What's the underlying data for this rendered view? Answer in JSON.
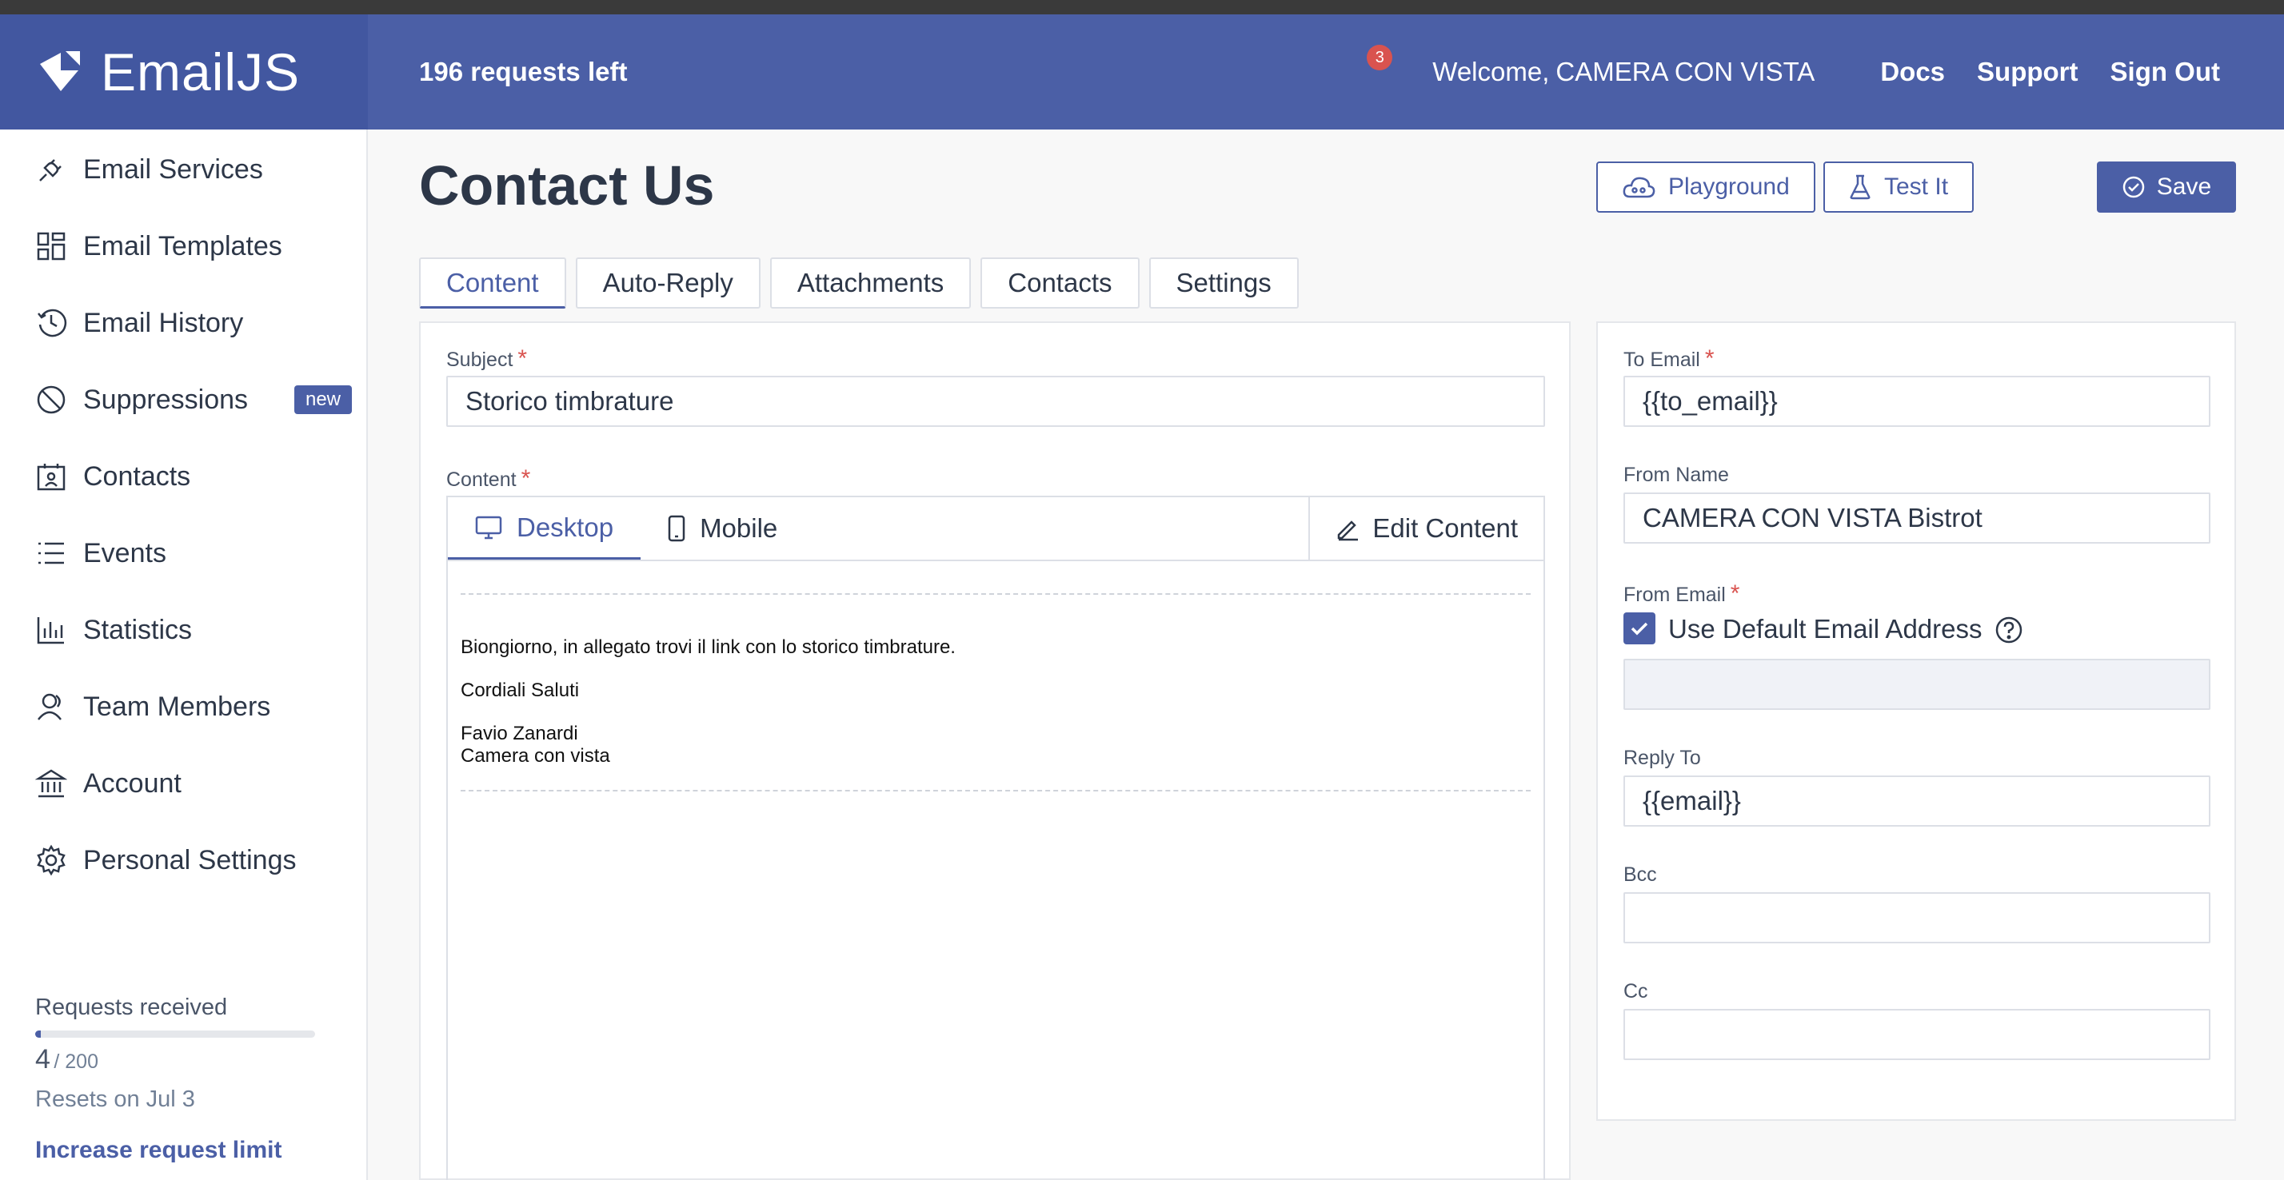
{
  "header": {
    "brand": "EmailJS",
    "requests_left": "196 requests left",
    "notification_count": "3",
    "welcome": "Welcome,",
    "user_name": "CAMERA CON VISTA",
    "links": [
      "Docs",
      "Support",
      "Sign Out"
    ]
  },
  "sidebar": {
    "items": [
      {
        "label": "Email Services",
        "icon": "plug-icon"
      },
      {
        "label": "Email Templates",
        "icon": "templates-icon"
      },
      {
        "label": "Email History",
        "icon": "history-icon"
      },
      {
        "label": "Suppressions",
        "icon": "block-icon",
        "badge": "new"
      },
      {
        "label": "Contacts",
        "icon": "contacts-icon"
      },
      {
        "label": "Events",
        "icon": "list-icon"
      },
      {
        "label": "Statistics",
        "icon": "chart-icon"
      },
      {
        "label": "Team Members",
        "icon": "team-icon"
      },
      {
        "label": "Account",
        "icon": "bank-icon"
      },
      {
        "label": "Personal Settings",
        "icon": "gear-icon"
      }
    ],
    "usage": {
      "label": "Requests received",
      "count": "4",
      "total": "/ 200",
      "fraction": 0.02,
      "reset": "Resets on Jul 3",
      "link": "Increase request limit"
    }
  },
  "page": {
    "title": "Contact Us",
    "buttons": {
      "playground": "Playground",
      "test": "Test It",
      "save": "Save"
    },
    "tabs": [
      "Content",
      "Auto-Reply",
      "Attachments",
      "Contacts",
      "Settings"
    ]
  },
  "content": {
    "subject_label": "Subject",
    "subject_value": "Storico timbrature",
    "content_label": "Content",
    "editor_tabs": {
      "desktop": "Desktop",
      "mobile": "Mobile",
      "edit": "Edit Content"
    },
    "email_lines": {
      "line1": "Biongiorno, in allegato trovi il link con lo storico timbrature.",
      "line2": "Cordiali Saluti",
      "line3": "Favio Zanardi",
      "line4": "Camera con vista"
    }
  },
  "settings": {
    "to_email_label": "To Email",
    "to_email_value": "{{to_email}}",
    "from_name_label": "From Name",
    "from_name_value": "CAMERA CON VISTA Bistrot",
    "from_email_label": "From Email",
    "use_default_label": "Use Default Email Address",
    "reply_to_label": "Reply To",
    "reply_to_value": "{{email}}",
    "bcc_label": "Bcc",
    "cc_label": "Cc"
  },
  "colors": {
    "accent": "#4b5fa6",
    "required": "#d9534f"
  }
}
